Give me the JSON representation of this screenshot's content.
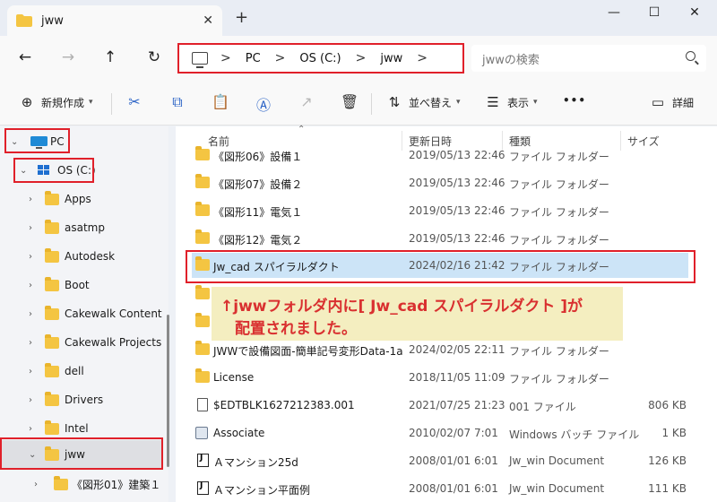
{
  "window": {
    "tab_title": "jww",
    "new_tab": "+",
    "minimize": "—",
    "maximize": "☐",
    "close": "✕",
    "tab_close": "✕"
  },
  "nav": {
    "back": "←",
    "forward": "→",
    "up": "↑",
    "refresh": "↻"
  },
  "address": {
    "sep": ">",
    "crumbs": [
      "PC",
      "OS (C:)",
      "jww"
    ]
  },
  "search": {
    "placeholder": "jwwの検索"
  },
  "commands": {
    "new_label": "新規作成",
    "sort_label": "並べ替え",
    "view_label": "表示",
    "more": "•••",
    "details_label": "詳細"
  },
  "tree": {
    "pc": "PC",
    "drive": "OS (C:)",
    "folders": [
      "Apps",
      "asatmp",
      "Autodesk",
      "Boot",
      "Cakewalk Content",
      "Cakewalk Projects",
      "dell",
      "Drivers",
      "Intel",
      "jww",
      "《図形01》建築１"
    ]
  },
  "columns": {
    "name": "名前",
    "modified": "更新日時",
    "type": "種類",
    "size": "サイズ"
  },
  "files": [
    {
      "name": "《図形06》設備１",
      "date": "2019/05/13 22:46",
      "type": "ファイル フォルダー",
      "size": "",
      "icon": "folder-icon"
    },
    {
      "name": "《図形07》設備２",
      "date": "2019/05/13 22:46",
      "type": "ファイル フォルダー",
      "size": "",
      "icon": "folder-icon"
    },
    {
      "name": "《図形11》電気１",
      "date": "2019/05/13 22:46",
      "type": "ファイル フォルダー",
      "size": "",
      "icon": "folder-icon"
    },
    {
      "name": "《図形12》電気２",
      "date": "2019/05/13 22:46",
      "type": "ファイル フォルダー",
      "size": "",
      "icon": "folder-icon"
    },
    {
      "name": "Jw_cad スパイラルダクト",
      "date": "2024/02/16 21:42",
      "type": "ファイル フォルダー",
      "size": "",
      "icon": "folder-icon"
    },
    {
      "name": "",
      "date": "",
      "type": "",
      "size": "",
      "icon": "folder-icon"
    },
    {
      "name": "",
      "date": "",
      "type": "",
      "size": "",
      "icon": "folder-icon"
    },
    {
      "name": "JWWで設備図面-簡単記号変形Data-1a",
      "date": "2024/02/05 22:11",
      "type": "ファイル フォルダー",
      "size": "",
      "icon": "folder-icon"
    },
    {
      "name": "License",
      "date": "2018/11/05 11:09",
      "type": "ファイル フォルダー",
      "size": "",
      "icon": "folder-icon"
    },
    {
      "name": "$EDTBLK1627212383.001",
      "date": "2021/07/25 21:23",
      "type": "001 ファイル",
      "size": "806 KB",
      "icon": "file-icon"
    },
    {
      "name": "Associate",
      "date": "2010/02/07 7:01",
      "type": "Windows バッチ ファイル",
      "size": "1 KB",
      "icon": "batch-icon"
    },
    {
      "name": "Ａマンション25d",
      "date": "2008/01/01 6:01",
      "type": "Jw_win Document",
      "size": "126 KB",
      "icon": "jw-icon"
    },
    {
      "name": "Ａマンション平面例",
      "date": "2008/01/01 6:01",
      "type": "Jw_win Document",
      "size": "111 KB",
      "icon": "jw-icon"
    }
  ],
  "annotation": {
    "line1": "↑jwwフォルダ内に[ Jw_cad スパイラルダクト ]が",
    "line2": "配置されました。"
  }
}
